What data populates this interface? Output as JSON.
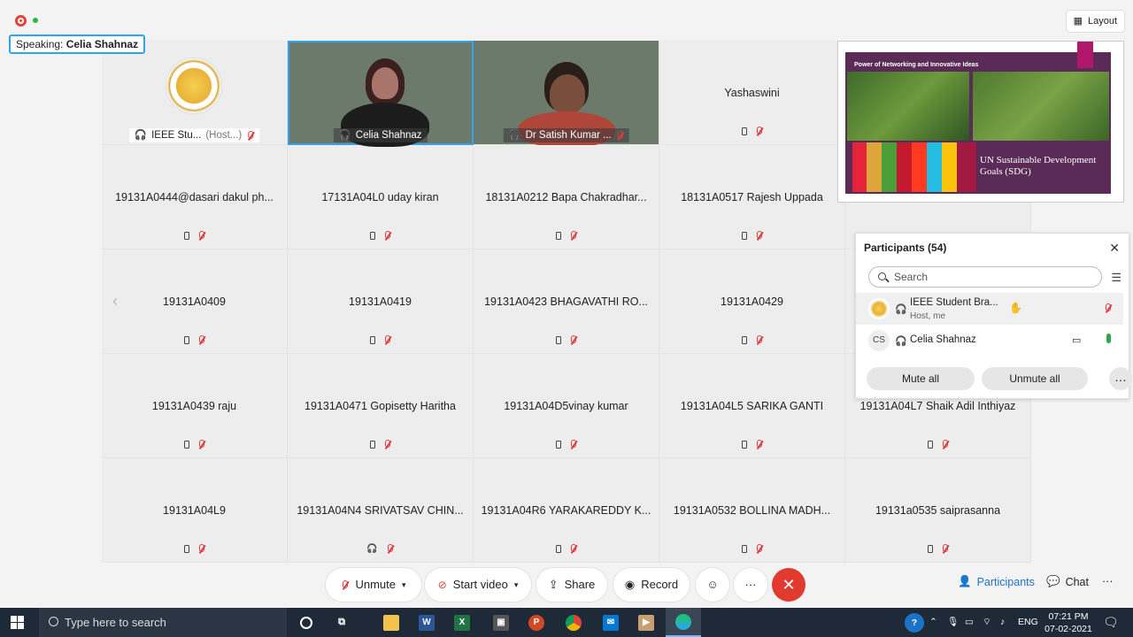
{
  "speaking": {
    "label": "Speaking:",
    "name": "Celia Shahnaz"
  },
  "layout_button": {
    "label": "Layout"
  },
  "tiles": [
    {
      "name": "IEEE Stu...",
      "host_tag": "(Host...)",
      "kind": "logo"
    },
    {
      "name": "Celia Shahnaz",
      "kind": "video",
      "active": true
    },
    {
      "name": "Dr Satish Kumar ...",
      "kind": "video"
    },
    {
      "name": "Yashaswini"
    },
    {
      "name": ""
    },
    {
      "name": "19131A0444@dasari dakul ph..."
    },
    {
      "name": "17131A04L0 uday kiran"
    },
    {
      "name": "18131A0212 Bapa Chakradhar..."
    },
    {
      "name": "18131A0517 Rajesh Uppada"
    },
    {
      "name": ""
    },
    {
      "name": "19131A0409"
    },
    {
      "name": "19131A0419"
    },
    {
      "name": "19131A0423 BHAGAVATHI RO..."
    },
    {
      "name": "19131A0429"
    },
    {
      "name": ""
    },
    {
      "name": "19131A0439 raju"
    },
    {
      "name": "19131A0471 Gopisetty Haritha"
    },
    {
      "name": "19131A04D5vinay kumar"
    },
    {
      "name": "19131A04L5 SARIKA GANTI"
    },
    {
      "name": "19131A04L7 Shaik Adil Inthiyaz"
    },
    {
      "name": "19131A04L9"
    },
    {
      "name": "19131A04N4 SRIVATSAV CHIN..."
    },
    {
      "name": "19131A04R6 YARAKAREDDY K..."
    },
    {
      "name": "19131A0532 BOLLINA MADH..."
    },
    {
      "name": "19131a0535 saiprasanna"
    }
  ],
  "shared_content": {
    "slide_title": "Power of Networking and Innovative Ideas",
    "sdg_text": "UN Sustainable Development Goals (SDG)"
  },
  "participants_panel": {
    "title": "Participants (54)",
    "search_placeholder": "Search",
    "rows": [
      {
        "name": "IEEE Student Bra...",
        "sub": "Host, me",
        "avatar": ""
      },
      {
        "name": "Celia Shahnaz",
        "sub": "",
        "avatar": "CS"
      }
    ],
    "mute_all": "Mute all",
    "unmute_all": "Unmute all"
  },
  "controls": {
    "unmute": "Unmute",
    "start_video": "Start video",
    "share": "Share",
    "record": "Record",
    "participants": "Participants",
    "chat": "Chat"
  },
  "taskbar": {
    "search_placeholder": "Type here to search",
    "lang": "ENG",
    "time": "07:21 PM",
    "date": "07-02-2021"
  },
  "colors": {
    "accent": "#2fa3f0",
    "end_call": "#e03b2e",
    "mic_muted": "#e03b3b",
    "taskbar": "#1f2a38"
  }
}
